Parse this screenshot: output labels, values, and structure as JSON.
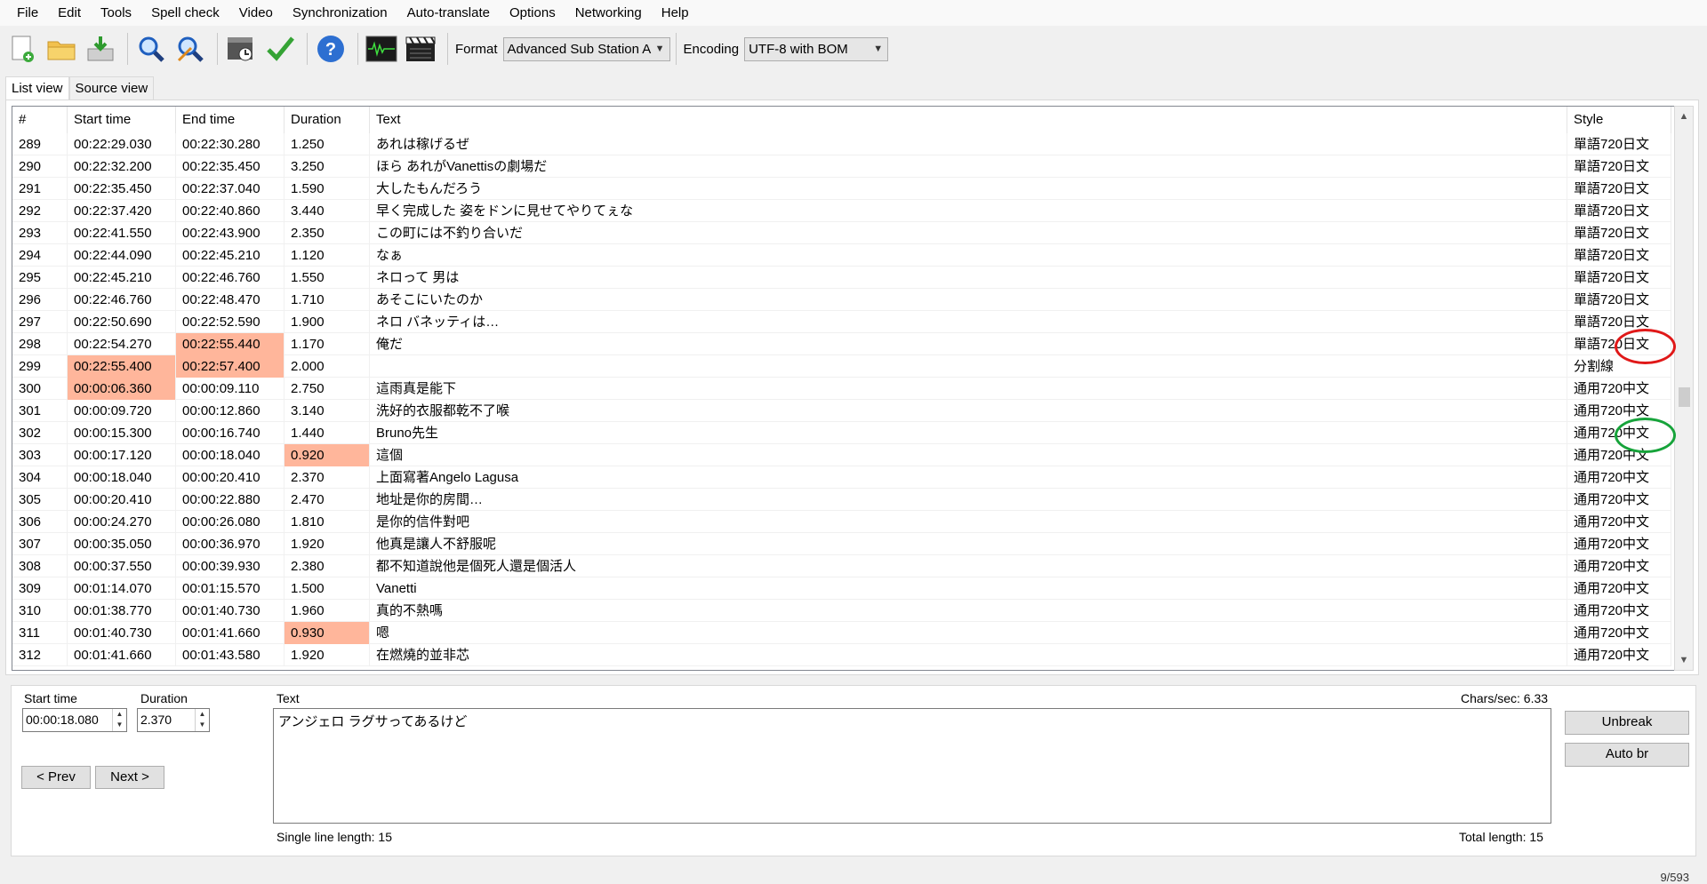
{
  "menu": [
    "File",
    "Edit",
    "Tools",
    "Spell check",
    "Video",
    "Synchronization",
    "Auto-translate",
    "Options",
    "Networking",
    "Help"
  ],
  "toolbar": {
    "format_label": "Format",
    "format_value": "Advanced Sub Station A",
    "encoding_label": "Encoding",
    "encoding_value": "UTF-8 with BOM"
  },
  "tabs": [
    "List view",
    "Source view"
  ],
  "columns": [
    "#",
    "Start time",
    "End time",
    "Duration",
    "Text",
    "Style"
  ],
  "rows": [
    {
      "num": "289",
      "start": "00:22:29.030",
      "end": "00:22:30.280",
      "dur": "1.250",
      "text": "あれは稼げるぜ",
      "style": "單語720日文",
      "warn": []
    },
    {
      "num": "290",
      "start": "00:22:32.200",
      "end": "00:22:35.450",
      "dur": "3.250",
      "text": "ほら あれがVanettisの劇場だ",
      "style": "單語720日文",
      "warn": []
    },
    {
      "num": "291",
      "start": "00:22:35.450",
      "end": "00:22:37.040",
      "dur": "1.590",
      "text": "大したもんだろう",
      "style": "單語720日文",
      "warn": []
    },
    {
      "num": "292",
      "start": "00:22:37.420",
      "end": "00:22:40.860",
      "dur": "3.440",
      "text": "早く完成した 姿をドンに見せてやりてぇな",
      "style": "單語720日文",
      "warn": []
    },
    {
      "num": "293",
      "start": "00:22:41.550",
      "end": "00:22:43.900",
      "dur": "2.350",
      "text": "この町には不釣り合いだ",
      "style": "單語720日文",
      "warn": []
    },
    {
      "num": "294",
      "start": "00:22:44.090",
      "end": "00:22:45.210",
      "dur": "1.120",
      "text": "なぁ",
      "style": "單語720日文",
      "warn": []
    },
    {
      "num": "295",
      "start": "00:22:45.210",
      "end": "00:22:46.760",
      "dur": "1.550",
      "text": "ネロって 男は",
      "style": "單語720日文",
      "warn": []
    },
    {
      "num": "296",
      "start": "00:22:46.760",
      "end": "00:22:48.470",
      "dur": "1.710",
      "text": "あそこにいたのか",
      "style": "單語720日文",
      "warn": []
    },
    {
      "num": "297",
      "start": "00:22:50.690",
      "end": "00:22:52.590",
      "dur": "1.900",
      "text": "ネロ バネッティは…",
      "style": "單語720日文",
      "warn": []
    },
    {
      "num": "298",
      "start": "00:22:54.270",
      "end": "00:22:55.440",
      "dur": "1.170",
      "text": "俺だ",
      "style": "單語720日文",
      "warn": [
        "end"
      ]
    },
    {
      "num": "299",
      "start": "00:22:55.400",
      "end": "00:22:57.400",
      "dur": "2.000",
      "text": "",
      "style": "分割線",
      "warn": [
        "start",
        "end"
      ]
    },
    {
      "num": "300",
      "start": "00:00:06.360",
      "end": "00:00:09.110",
      "dur": "2.750",
      "text": "這雨真是能下",
      "style": "通用720中文",
      "warn": [
        "start"
      ]
    },
    {
      "num": "301",
      "start": "00:00:09.720",
      "end": "00:00:12.860",
      "dur": "3.140",
      "text": "洗好的衣服都乾不了喉",
      "style": "通用720中文",
      "warn": []
    },
    {
      "num": "302",
      "start": "00:00:15.300",
      "end": "00:00:16.740",
      "dur": "1.440",
      "text": "Bruno先生",
      "style": "通用720中文",
      "warn": []
    },
    {
      "num": "303",
      "start": "00:00:17.120",
      "end": "00:00:18.040",
      "dur": "0.920",
      "text": "這個",
      "style": "通用720中文",
      "warn": [
        "dur"
      ]
    },
    {
      "num": "304",
      "start": "00:00:18.040",
      "end": "00:00:20.410",
      "dur": "2.370",
      "text": "上面寫著Angelo Lagusa",
      "style": "通用720中文",
      "warn": []
    },
    {
      "num": "305",
      "start": "00:00:20.410",
      "end": "00:00:22.880",
      "dur": "2.470",
      "text": "地址是你的房間…",
      "style": "通用720中文",
      "warn": []
    },
    {
      "num": "306",
      "start": "00:00:24.270",
      "end": "00:00:26.080",
      "dur": "1.810",
      "text": "是你的信件對吧",
      "style": "通用720中文",
      "warn": []
    },
    {
      "num": "307",
      "start": "00:00:35.050",
      "end": "00:00:36.970",
      "dur": "1.920",
      "text": "他真是讓人不舒服呢",
      "style": "通用720中文",
      "warn": []
    },
    {
      "num": "308",
      "start": "00:00:37.550",
      "end": "00:00:39.930",
      "dur": "2.380",
      "text": "都不知道說他是個死人還是個活人",
      "style": "通用720中文",
      "warn": []
    },
    {
      "num": "309",
      "start": "00:01:14.070",
      "end": "00:01:15.570",
      "dur": "1.500",
      "text": "Vanetti",
      "style": "通用720中文",
      "warn": []
    },
    {
      "num": "310",
      "start": "00:01:38.770",
      "end": "00:01:40.730",
      "dur": "1.960",
      "text": "真的不熱嗎",
      "style": "通用720中文",
      "warn": []
    },
    {
      "num": "311",
      "start": "00:01:40.730",
      "end": "00:01:41.660",
      "dur": "0.930",
      "text": "嗯",
      "style": "通用720中文",
      "warn": [
        "dur"
      ]
    },
    {
      "num": "312",
      "start": "00:01:41.660",
      "end": "00:01:43.580",
      "dur": "1.920",
      "text": "在燃燒的並非芯",
      "style": "通用720中文",
      "warn": []
    }
  ],
  "editor": {
    "start_label": "Start time",
    "start_value": "00:00:18.080",
    "duration_label": "Duration",
    "duration_value": "2.370",
    "text_label": "Text",
    "chars_sec": "Chars/sec: 6.33",
    "text_value": "アンジェロ ラグサってあるけど",
    "prev_label": "< Prev",
    "next_label": "Next >",
    "unbreak_label": "Unbreak",
    "autobr_label": "Auto br",
    "single_line": "Single line length: 15",
    "total_length": "Total length: 15"
  },
  "status": "9/593",
  "colors": {
    "warn": "#ffb69b",
    "red_ring": "#e01818",
    "green_ring": "#16a33a"
  }
}
